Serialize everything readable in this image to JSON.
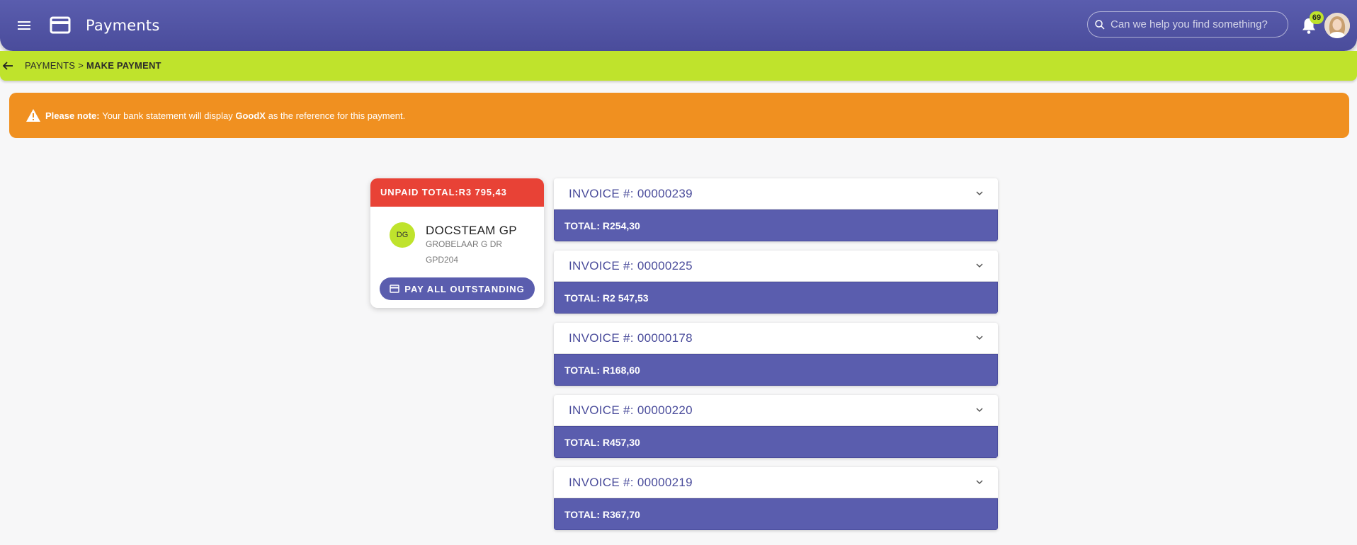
{
  "header": {
    "title": "Payments",
    "search_placeholder": "Can we help you find something?",
    "notification_count": "69"
  },
  "breadcrumb": {
    "parent": "PAYMENTS",
    "separator": ">",
    "current": "MAKE PAYMENT"
  },
  "notice": {
    "lead": "Please note:",
    "text_before": "Your bank statement will display",
    "reference": "GoodX",
    "text_after": "as the reference for this payment."
  },
  "summary": {
    "unpaid_label": "UNPAID TOTAL:R3 795,43",
    "initials": "DG",
    "practice_name": "DOCSTEAM GP",
    "doctor": "GROBELAAR G DR",
    "code": "GPD204",
    "pay_all_label": "PAY ALL OUTSTANDING"
  },
  "invoices": [
    {
      "label": "INVOICE #: 00000239",
      "total": "TOTAL: R254,30"
    },
    {
      "label": "INVOICE #: 00000225",
      "total": "TOTAL: R2 547,53"
    },
    {
      "label": "INVOICE #: 00000178",
      "total": "TOTAL: R168,60"
    },
    {
      "label": "INVOICE #: 00000220",
      "total": "TOTAL: R457,30"
    },
    {
      "label": "INVOICE #: 00000219",
      "total": "TOTAL: R367,70"
    }
  ],
  "colors": {
    "primary": "#5a5dae",
    "accent_green": "#bfe32c",
    "warning_orange": "#f09020",
    "unpaid_red": "#e84236"
  }
}
